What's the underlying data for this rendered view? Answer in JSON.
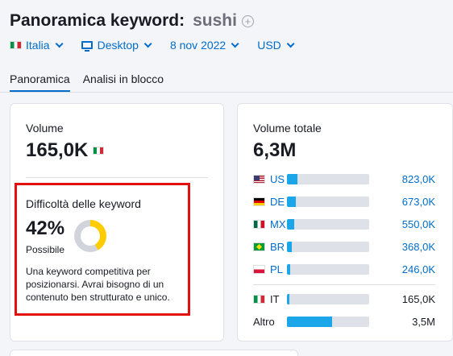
{
  "header": {
    "title": "Panoramica keyword:",
    "keyword": "sushi",
    "filters": {
      "country": "Italia",
      "device": "Desktop",
      "date": "8 nov 2022",
      "currency": "USD"
    },
    "tabs": [
      "Panoramica",
      "Analisi in blocco"
    ]
  },
  "volume": {
    "label": "Volume",
    "value": "165,0K"
  },
  "kd": {
    "label": "Difficoltà delle keyword",
    "value": "42%",
    "level": "Possibile",
    "percent": 42,
    "description": "Una keyword competitiva per posizionarsi. Avrai bisogno di un contenuto ben strutturato e unico."
  },
  "global": {
    "label": "Volume totale",
    "value": "6,3M",
    "rows": [
      {
        "code": "US",
        "value": "823,0K",
        "share": 0.13
      },
      {
        "code": "DE",
        "value": "673,0K",
        "share": 0.11
      },
      {
        "code": "MX",
        "value": "550,0K",
        "share": 0.09
      },
      {
        "code": "BR",
        "value": "368,0K",
        "share": 0.06
      },
      {
        "code": "PL",
        "value": "246,0K",
        "share": 0.04
      }
    ],
    "it": {
      "code": "IT",
      "value": "165,0K",
      "share": 0.03
    },
    "other": {
      "code": "Altro",
      "value": "3,5M",
      "share": 0.55
    }
  },
  "colors": {
    "accent": "#006dca",
    "bar": "#1aa6e8",
    "kd_fill": "#ffcc00",
    "highlight": "#e31010"
  }
}
